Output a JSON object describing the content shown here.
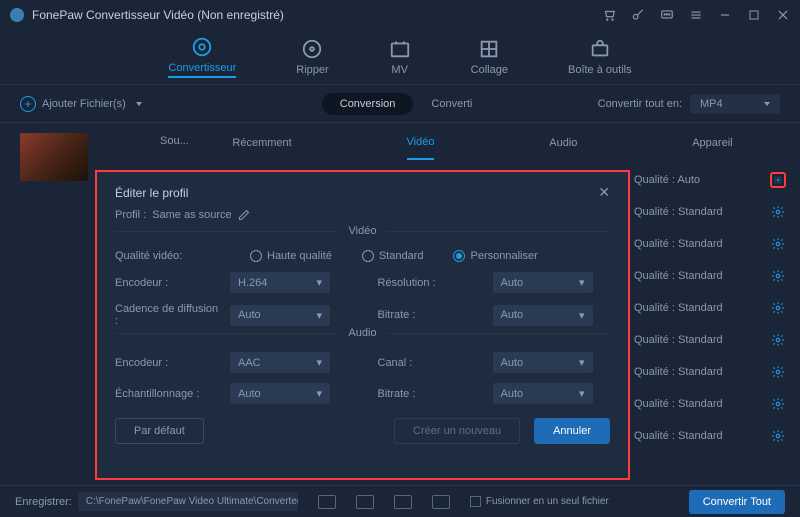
{
  "title": "FonePaw Convertisseur Vidéo (Non enregistré)",
  "main_tabs": {
    "convert": "Convertisseur",
    "ripper": "Ripper",
    "mv": "MV",
    "collage": "Collage",
    "toolbox": "Boîte à outils"
  },
  "toolbar": {
    "add": "Ajouter Fichier(s)",
    "conversion": "Conversion",
    "converti": "Converti",
    "convert_all_in": "Convertir tout en:",
    "format": "MP4"
  },
  "src": "Sou...",
  "cat_tabs": {
    "recent": "Récemment",
    "video": "Vidéo",
    "audio": "Audio",
    "device": "Appareil"
  },
  "profiles": [
    {
      "label": "Qualité : Auto",
      "highlight": true
    },
    {
      "label": "Qualité : Standard"
    },
    {
      "label": "Qualité : Standard"
    },
    {
      "label": "Qualité : Standard"
    },
    {
      "label": "Qualité : Standard"
    },
    {
      "label": "Qualité : Standard"
    },
    {
      "label": "Qualité : Standard"
    },
    {
      "label": "Qualité : Standard"
    },
    {
      "label": "Qualité : Standard"
    }
  ],
  "dialog": {
    "title": "Éditer le profil",
    "profil_label": "Profil :",
    "profil_value": "Same as source",
    "sect_video": "Vidéo",
    "sect_audio": "Audio",
    "quality_label": "Qualité vidéo:",
    "quality_opts": {
      "high": "Haute qualité",
      "standard": "Standard",
      "custom": "Personnaliser"
    },
    "encoder_label": "Encodeur :",
    "encoder_val": "H.264",
    "resolution_label": "Résolution :",
    "resolution_val": "Auto",
    "framerate_label": "Cadence de diffusion :",
    "framerate_val": "Auto",
    "bitrate_label": "Bitrate :",
    "bitrate_val": "Auto",
    "a_encoder_label": "Encodeur :",
    "a_encoder_val": "AAC",
    "channel_label": "Canal :",
    "channel_val": "Auto",
    "sample_label": "Échantillonnage :",
    "sample_val": "Auto",
    "a_bitrate_label": "Bitrate :",
    "a_bitrate_val": "Auto",
    "by_default": "Par défaut",
    "create_new": "Créer un nouveau",
    "cancel": "Annuler"
  },
  "footer": {
    "save_to": "Enregistrer:",
    "path": "C:\\FonePaw\\FonePaw Video Ultimate\\Converted",
    "merge": "Fusionner en un seul fichier",
    "convert_all": "Convertir Tout"
  }
}
